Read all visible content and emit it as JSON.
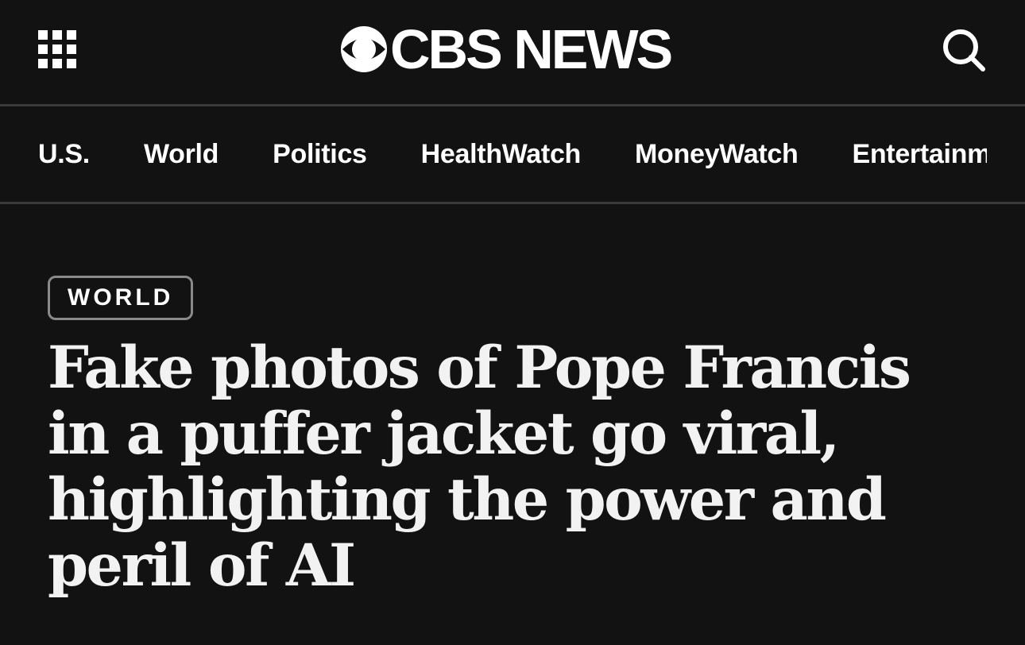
{
  "header": {
    "menu_icon": "grid-menu-icon",
    "logo_icon": "cbs-eye-icon",
    "logo_text": "CBS NEWS",
    "search_icon": "search-icon"
  },
  "nav": {
    "items": [
      {
        "label": "U.S."
      },
      {
        "label": "World"
      },
      {
        "label": "Politics"
      },
      {
        "label": "HealthWatch"
      },
      {
        "label": "MoneyWatch"
      },
      {
        "label": "Entertainment"
      }
    ]
  },
  "article": {
    "category": "WORLD",
    "headline": "Fake photos of Pope Francis in a puffer jacket go viral, highlighting the power and peril of AI"
  },
  "colors": {
    "background": "#121212",
    "text": "#ffffff",
    "divider": "#3a3a3a",
    "badge_border": "#8a8a8a"
  }
}
